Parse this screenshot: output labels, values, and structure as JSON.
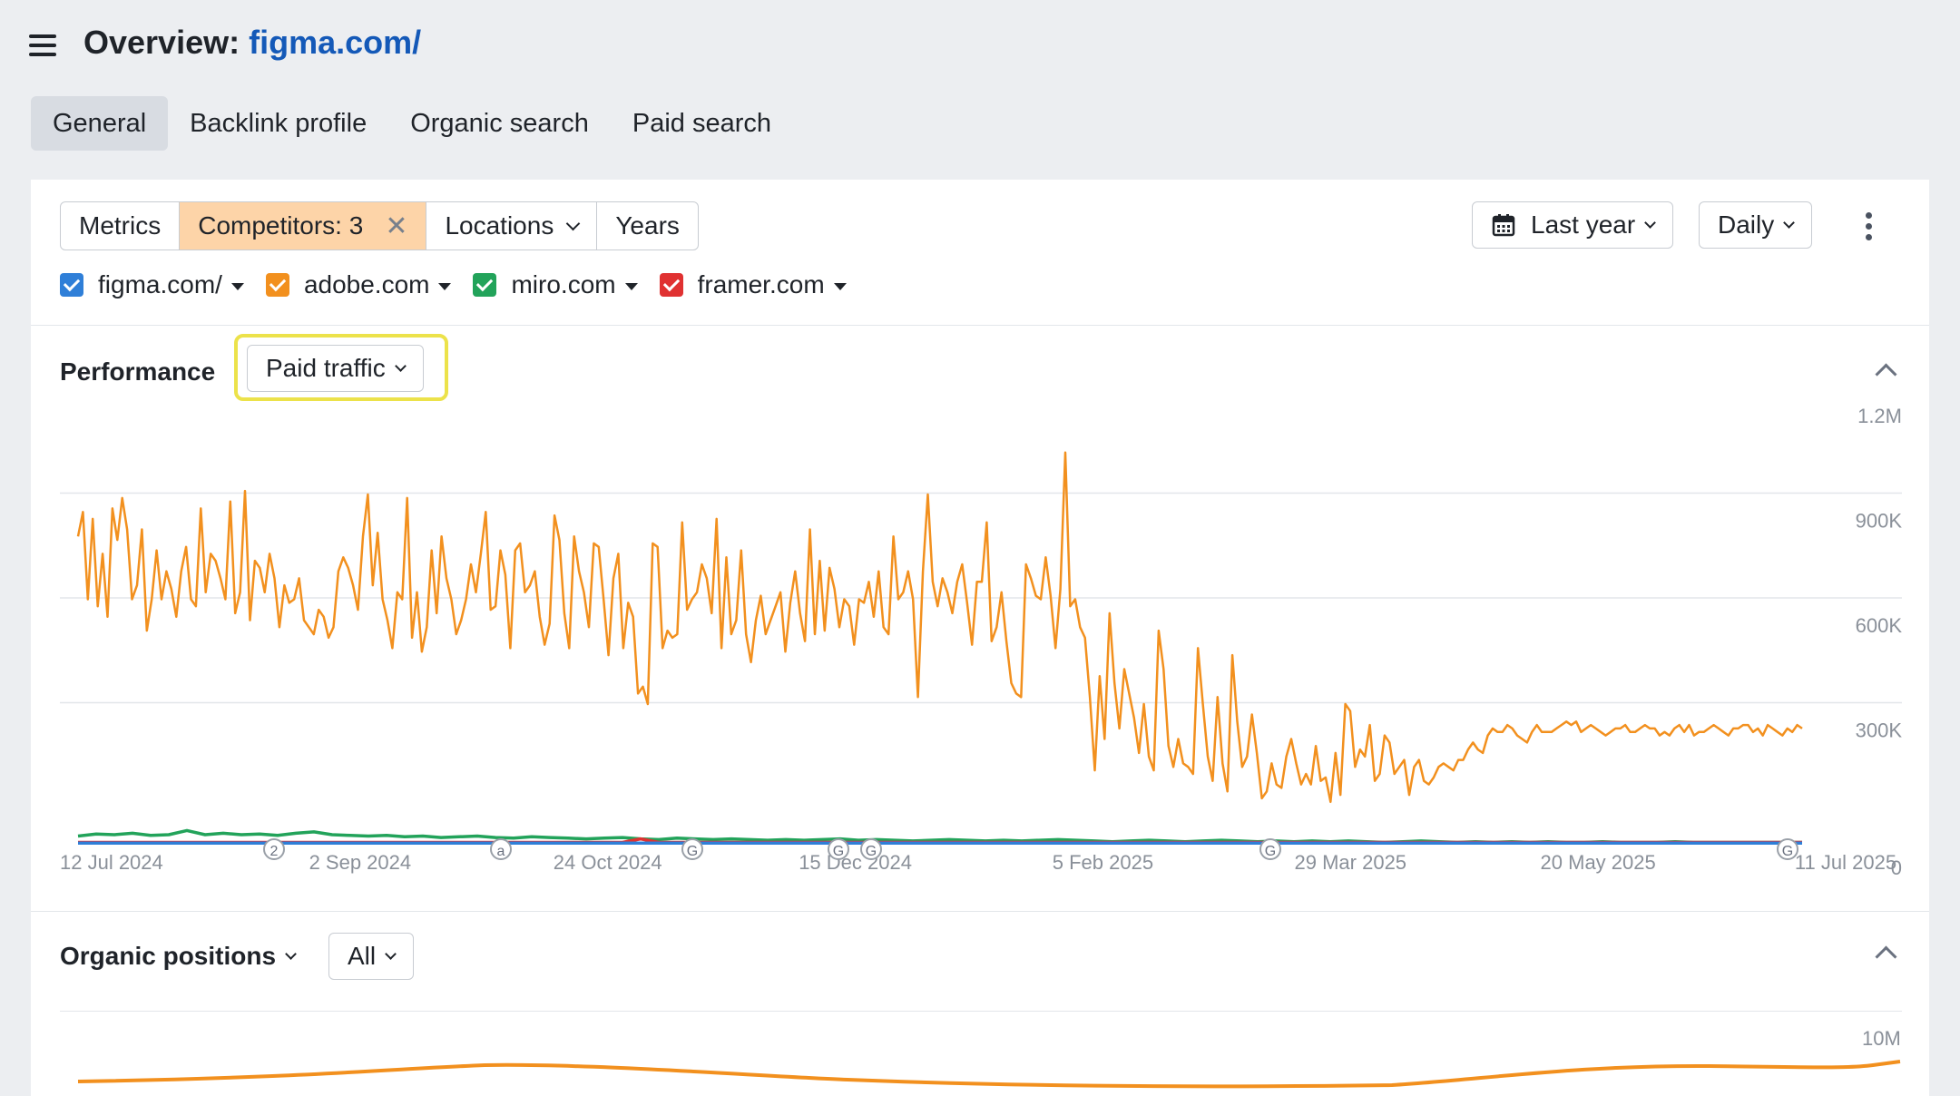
{
  "header": {
    "title_prefix": "Overview:",
    "domain": "figma.com/"
  },
  "tabs": [
    {
      "label": "General",
      "active": true
    },
    {
      "label": "Backlink profile",
      "active": false
    },
    {
      "label": "Organic search",
      "active": false
    },
    {
      "label": "Paid search",
      "active": false
    }
  ],
  "toolbar": {
    "metrics": "Metrics",
    "competitors": "Competitors: 3",
    "locations": "Locations",
    "years": "Years",
    "date_range": "Last year",
    "granularity": "Daily"
  },
  "competitors": [
    {
      "name": "figma.com/",
      "color": "#2f7fd8"
    },
    {
      "name": "adobe.com",
      "color": "#f2901e"
    },
    {
      "name": "miro.com",
      "color": "#22a35a"
    },
    {
      "name": "framer.com",
      "color": "#e03131"
    }
  ],
  "performance": {
    "title": "Performance",
    "metric": "Paid traffic"
  },
  "organic": {
    "title": "Organic positions",
    "filter": "All",
    "ytop": "10M"
  },
  "chart_data": {
    "type": "line",
    "ylim": [
      0,
      1200000
    ],
    "y_ticks": [
      "1.2M",
      "900K",
      "600K",
      "300K",
      "0"
    ],
    "x_ticks": [
      "12 Jul 2024",
      "2 Sep 2024",
      "24 Oct 2024",
      "15 Dec 2024",
      "5 Feb 2025",
      "29 Mar 2025",
      "20 May 2025",
      "11 Jul 2025"
    ],
    "annotations": [
      {
        "label": "2",
        "date": "2 Sep 2024"
      },
      {
        "label": "a",
        "date": "16 Oct 2024"
      },
      {
        "label": "G",
        "date": "24 Oct 2024"
      },
      {
        "label": "G",
        "date": "15 Dec 2024"
      },
      {
        "label": "G",
        "date": "24 Dec 2024"
      },
      {
        "label": "G",
        "date": "29 Mar 2025"
      },
      {
        "label": "G",
        "date": "11 Jul 2025"
      }
    ],
    "series": [
      {
        "name": "adobe.com",
        "color": "#f2901e",
        "values": [
          880000,
          950000,
          700000,
          930000,
          680000,
          830000,
          650000,
          960000,
          870000,
          990000,
          900000,
          700000,
          740000,
          900000,
          610000,
          700000,
          840000,
          700000,
          780000,
          730000,
          650000,
          780000,
          850000,
          700000,
          680000,
          960000,
          720000,
          830000,
          810000,
          760000,
          700000,
          980000,
          660000,
          720000,
          1010000,
          640000,
          810000,
          790000,
          720000,
          830000,
          760000,
          620000,
          740000,
          690000,
          700000,
          760000,
          640000,
          620000,
          600000,
          670000,
          650000,
          590000,
          620000,
          780000,
          820000,
          790000,
          740000,
          670000,
          880000,
          1000000,
          740000,
          890000,
          700000,
          640000,
          560000,
          720000,
          700000,
          990000,
          590000,
          720000,
          550000,
          620000,
          840000,
          660000,
          880000,
          760000,
          700000,
          600000,
          640000,
          700000,
          800000,
          720000,
          830000,
          950000,
          670000,
          680000,
          840000,
          770000,
          560000,
          840000,
          860000,
          720000,
          740000,
          780000,
          650000,
          570000,
          630000,
          940000,
          870000,
          660000,
          560000,
          880000,
          780000,
          720000,
          620000,
          860000,
          850000,
          700000,
          540000,
          760000,
          830000,
          560000,
          690000,
          650000,
          430000,
          450000,
          400000,
          860000,
          850000,
          560000,
          610000,
          590000,
          600000,
          920000,
          670000,
          700000,
          720000,
          800000,
          760000,
          660000,
          930000,
          560000,
          820000,
          600000,
          640000,
          840000,
          600000,
          520000,
          640000,
          710000,
          600000,
          640000,
          680000,
          720000,
          550000,
          690000,
          780000,
          660000,
          580000,
          900000,
          600000,
          810000,
          610000,
          790000,
          730000,
          620000,
          700000,
          680000,
          570000,
          700000,
          690000,
          750000,
          650000,
          780000,
          620000,
          600000,
          880000,
          700000,
          720000,
          780000,
          700000,
          420000,
          780000,
          1000000,
          750000,
          680000,
          760000,
          720000,
          660000,
          750000,
          800000,
          690000,
          570000,
          750000,
          750000,
          920000,
          580000,
          620000,
          720000,
          580000,
          460000,
          430000,
          420000,
          800000,
          760000,
          710000,
          700000,
          820000,
          710000,
          560000,
          730000,
          1120000,
          680000,
          700000,
          620000,
          590000,
          420000,
          210000,
          480000,
          300000,
          660000,
          460000,
          330000,
          500000,
          430000,
          360000,
          260000,
          400000,
          250000,
          210000,
          610000,
          500000,
          280000,
          220000,
          300000,
          230000,
          220000,
          200000,
          560000,
          400000,
          250000,
          180000,
          420000,
          230000,
          150000,
          540000,
          350000,
          220000,
          250000,
          370000,
          260000,
          130000,
          150000,
          230000,
          170000,
          160000,
          250000,
          300000,
          230000,
          170000,
          200000,
          170000,
          280000,
          180000,
          190000,
          120000,
          260000,
          140000,
          400000,
          380000,
          220000,
          270000,
          250000,
          340000,
          180000,
          200000,
          310000,
          290000,
          200000,
          220000,
          240000,
          140000,
          220000,
          240000,
          180000,
          170000,
          190000,
          220000,
          230000,
          220000,
          210000,
          240000,
          240000,
          270000,
          290000,
          270000,
          260000,
          310000,
          330000,
          320000,
          320000,
          340000,
          330000,
          310000,
          300000,
          290000,
          320000,
          340000,
          320000,
          320000,
          320000,
          330000,
          340000,
          350000,
          340000,
          350000,
          320000,
          330000,
          340000,
          330000,
          320000,
          310000,
          320000,
          330000,
          330000,
          340000,
          320000,
          320000,
          330000,
          340000,
          330000,
          330000,
          310000,
          320000,
          310000,
          330000,
          340000,
          320000,
          340000,
          310000,
          320000,
          320000,
          330000,
          340000,
          330000,
          320000,
          310000,
          330000,
          330000,
          340000,
          340000,
          320000,
          330000,
          310000,
          340000,
          330000,
          320000,
          310000,
          330000,
          320000,
          340000,
          330000
        ]
      },
      {
        "name": "miro.com",
        "color": "#22a35a",
        "values": [
          22000,
          28000,
          26000,
          30000,
          24000,
          26000,
          38000,
          26000,
          30000,
          26000,
          28000,
          24000,
          30000,
          34000,
          26000,
          24000,
          22000,
          24000,
          20000,
          22000,
          18000,
          20000,
          22000,
          18000,
          16000,
          20000,
          18000,
          16000,
          14000,
          16000,
          18000,
          14000,
          12000,
          16000,
          14000,
          12000,
          14000,
          12000,
          10000,
          12000,
          10000,
          12000,
          14000,
          10000,
          12000,
          10000,
          8000,
          10000,
          12000,
          10000,
          8000,
          10000,
          8000,
          10000,
          12000,
          10000,
          8000,
          6000,
          8000,
          10000,
          8000,
          6000,
          8000,
          10000,
          8000,
          6000,
          8000,
          6000,
          8000,
          6000,
          8000,
          6000,
          4000,
          6000,
          8000,
          6000,
          4000,
          6000,
          4000,
          6000,
          4000,
          6000,
          4000,
          4000,
          6000,
          4000,
          4000,
          4000,
          6000,
          4000,
          4000,
          4000,
          4000,
          4000,
          4000,
          4000
        ]
      },
      {
        "name": "framer.com",
        "color": "#e03131",
        "values": [
          4000,
          4000,
          4000,
          4000,
          4000,
          4000,
          4000,
          4000,
          4000,
          4000,
          4000,
          4000,
          4000,
          4000,
          4000,
          4000,
          4000,
          4000,
          4000,
          4000,
          4000,
          4000,
          4000,
          4000,
          4000,
          4000,
          4000,
          4000,
          4000,
          4000,
          4000,
          14000,
          4000,
          4000,
          4000,
          4000,
          4000,
          4000,
          4000,
          4000,
          4000,
          4000,
          4000,
          4000,
          4000,
          4000,
          4000,
          4000,
          4000,
          4000,
          4000,
          4000,
          4000,
          4000,
          4000,
          4000,
          4000,
          4000,
          4000,
          4000,
          4000,
          4000,
          4000,
          4000,
          4000,
          4000,
          4000,
          4000,
          4000,
          4000,
          4000,
          4000,
          4000,
          4000,
          4000,
          4000,
          4000,
          4000,
          4000,
          4000,
          4000,
          4000,
          4000,
          4000,
          4000,
          4000,
          4000,
          4000,
          4000,
          4000,
          4000,
          4000,
          4000,
          4000,
          4000,
          4000
        ]
      },
      {
        "name": "figma.com/",
        "color": "#2f7fd8",
        "values": [
          2000,
          2000,
          2000,
          2000,
          2000,
          2000,
          2000,
          2000,
          2000,
          2000,
          2000,
          2000,
          2000,
          2000,
          2000,
          2000,
          2000,
          2000,
          2000,
          2000,
          2000,
          2000,
          2000,
          2000,
          2000,
          2000,
          2000,
          2000,
          2000,
          2000,
          2000,
          2000,
          2000,
          2000,
          2000,
          2000,
          2000,
          2000,
          2000,
          2000,
          2000,
          2000,
          2000,
          2000,
          2000,
          2000,
          2000,
          2000,
          2000,
          2000,
          2000,
          2000,
          2000,
          2000,
          2000,
          2000,
          2000,
          2000,
          2000,
          2000,
          2000,
          2000,
          2000,
          2000,
          2000,
          2000,
          2000,
          2000,
          2000,
          2000,
          2000,
          2000,
          2000,
          2000,
          2000,
          2000,
          2000,
          2000,
          2000,
          2000,
          2000,
          2000,
          2000,
          2000,
          2000,
          2000,
          2000,
          2000,
          2000,
          2000,
          2000,
          2000,
          2000,
          2000,
          2000,
          2000
        ]
      }
    ]
  }
}
